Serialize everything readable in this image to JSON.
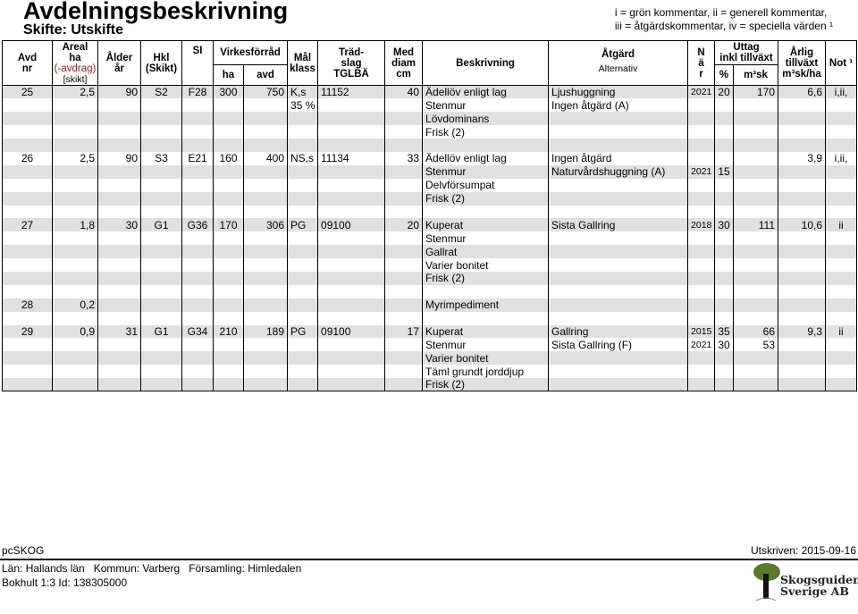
{
  "header": {
    "title": "Avdelningsbeskrivning",
    "subtitle": "Skifte: Utskifte",
    "legend_line1": "i = grön kommentar, ii = generell kommentar,",
    "legend_line2": "iii = åtgärdskommentar, iv = speciella värden ¹"
  },
  "columns": {
    "avd1": "Avd",
    "avd2": "nr",
    "areal1": "Areal",
    "areal2": "ha",
    "areal3": "(-avdrag)",
    "areal4": "[skikt]",
    "alder1": "Ålder",
    "alder2": "år",
    "hkl1": "Hkl",
    "hkl2": "(Skikt)",
    "si": "SI",
    "virke": "Virkesförråd",
    "virke_ha": "ha",
    "virke_avd": "avd",
    "mal1": "Mål",
    "mal2": "klass",
    "trad1": "Träd-",
    "trad2": "slag",
    "trad3": "TGLBÄ",
    "diam1": "Med",
    "diam2": "diam",
    "diam3": "cm",
    "beskr": "Beskrivning",
    "atg1": "Åtgärd",
    "atg2": "Alternativ",
    "nar1": "N",
    "nar2": "ä",
    "nar3": "r",
    "uttag1": "Uttag",
    "uttag2": "inkl tillväxt",
    "uttag_pct": "%",
    "uttag_m3": "m³sk",
    "tv1": "Årlig",
    "tv2": "tillväxt",
    "tv3": "m³sk/ha",
    "not": "Not ¹"
  },
  "stands": [
    {
      "avd": "25",
      "areal": "2,5",
      "alder": "90",
      "hkl": "S2",
      "si": "F28",
      "vol_ha": "300",
      "vol_avd": "750",
      "malklass": [
        "K,s",
        "35 %"
      ],
      "tradslag": "11152",
      "diam": "40",
      "beskrivning": [
        "Ädellöv enligt lag",
        "Stenmur",
        "Lövdominans",
        "Frisk (2)"
      ],
      "atgard": [
        {
          "name": "Ljushuggning",
          "year": "2021",
          "pct": "20",
          "m3sk": "170"
        },
        {
          "name": "Ingen åtgärd (A)"
        }
      ],
      "tillvaxt": "6,6",
      "not": "i,ii,"
    },
    {
      "avd": "26",
      "areal": "2,5",
      "alder": "90",
      "hkl": "S3",
      "si": "E21",
      "vol_ha": "160",
      "vol_avd": "400",
      "malklass": [
        "NS,s"
      ],
      "tradslag": "11134",
      "diam": "33",
      "beskrivning": [
        "Ädellöv enligt lag",
        "Stenmur",
        "Delvförsumpat",
        "Frisk (2)"
      ],
      "atgard": [
        {
          "name": "Ingen åtgärd"
        },
        {
          "name": "Naturvårdshuggning (A)",
          "year": "2021",
          "pct": "15"
        }
      ],
      "tillvaxt": "3,9",
      "not": "i,ii,"
    },
    {
      "avd": "27",
      "areal": "1,8",
      "alder": "30",
      "hkl": "G1",
      "si": "G36",
      "vol_ha": "170",
      "vol_avd": "306",
      "malklass": [
        "PG"
      ],
      "tradslag": "09100",
      "diam": "20",
      "beskrivning": [
        "Kuperat",
        "Stenmur",
        "Gallrat",
        "Varier bonitet",
        "Frisk (2)"
      ],
      "atgard": [
        {
          "name": "Sista Gallring",
          "year": "2018",
          "pct": "30",
          "m3sk": "111"
        }
      ],
      "tillvaxt": "10,6",
      "not": "ii"
    },
    {
      "avd": "28",
      "areal": "0,2",
      "beskrivning": [
        "Myrimpediment"
      ],
      "atgard": [],
      "malklass": []
    },
    {
      "avd": "29",
      "areal": "0,9",
      "alder": "31",
      "hkl": "G1",
      "si": "G34",
      "vol_ha": "210",
      "vol_avd": "189",
      "malklass": [
        "PG"
      ],
      "tradslag": "09100",
      "diam": "17",
      "beskrivning": [
        "Kuperat",
        "Stenmur",
        "Varier bonitet",
        "Täml grundt jorddjup",
        "Frisk (2)"
      ],
      "atgard": [
        {
          "name": "Gallring",
          "year": "2015",
          "pct": "35",
          "m3sk": "66"
        },
        {
          "name": "Sista Gallring (F)",
          "year": "2021",
          "pct": "30",
          "m3sk": "53"
        }
      ],
      "tillvaxt": "9,3",
      "not": "ii"
    }
  ],
  "footer": {
    "software": "pcSKOG",
    "printed": "Utskriven: 2015-09-16",
    "location": "Län: Hallands län   Kommun: Varberg   Församling: Himledalen",
    "property": "Bokhult 1:3 Id: 138305000",
    "logo_text1": "Skogsguiden",
    "logo_text2": "Sverige AB",
    "logo_color": "#5a7a2a"
  }
}
